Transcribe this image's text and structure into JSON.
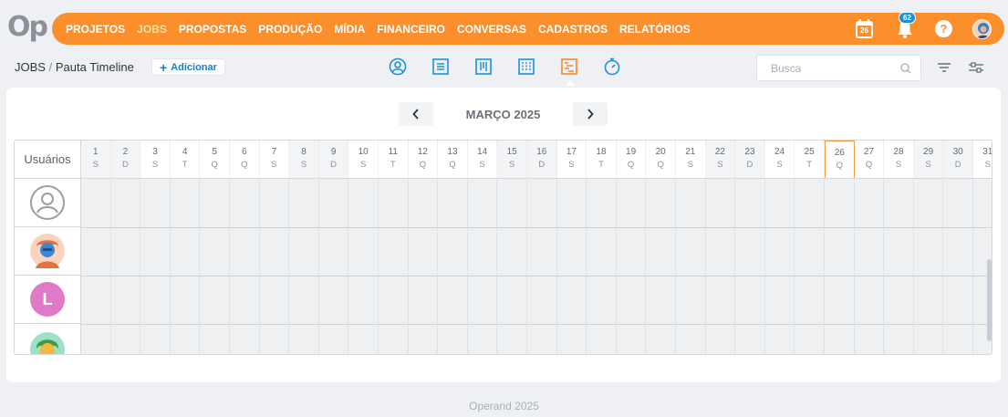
{
  "logo": "Op",
  "nav": {
    "items": [
      "PROJETOS",
      "JOBS",
      "PROPOSTAS",
      "PRODUÇÃO",
      "MÍDIA",
      "FINANCEIRO",
      "CONVERSAS",
      "CADASTROS",
      "RELATÓRIOS"
    ],
    "active": "JOBS",
    "calendar_day": "26",
    "notification_count": "62",
    "help": "?"
  },
  "breadcrumb": {
    "section": "JOBS",
    "separator": "/",
    "page": "Pauta Timeline"
  },
  "add_button": {
    "label": "Adicionar"
  },
  "views": [
    "user-icon",
    "list-icon",
    "kanban-icon",
    "columns-icon",
    "timeline-icon",
    "timer-icon"
  ],
  "active_view": "timeline-icon",
  "search": {
    "placeholder": "Busca"
  },
  "calendar": {
    "month_label": "MARÇO 2025",
    "users_header": "Usuários",
    "today": 26,
    "days": [
      {
        "n": "1",
        "d": "S",
        "we": true
      },
      {
        "n": "2",
        "d": "D",
        "we": true
      },
      {
        "n": "3",
        "d": "S"
      },
      {
        "n": "4",
        "d": "T"
      },
      {
        "n": "5",
        "d": "Q"
      },
      {
        "n": "6",
        "d": "Q"
      },
      {
        "n": "7",
        "d": "S"
      },
      {
        "n": "8",
        "d": "S",
        "we": true
      },
      {
        "n": "9",
        "d": "D",
        "we": true
      },
      {
        "n": "10",
        "d": "S"
      },
      {
        "n": "11",
        "d": "T"
      },
      {
        "n": "12",
        "d": "Q"
      },
      {
        "n": "13",
        "d": "Q"
      },
      {
        "n": "14",
        "d": "S"
      },
      {
        "n": "15",
        "d": "S",
        "we": true
      },
      {
        "n": "16",
        "d": "D",
        "we": true
      },
      {
        "n": "17",
        "d": "S"
      },
      {
        "n": "18",
        "d": "T"
      },
      {
        "n": "19",
        "d": "Q"
      },
      {
        "n": "20",
        "d": "Q"
      },
      {
        "n": "21",
        "d": "S"
      },
      {
        "n": "22",
        "d": "S",
        "we": true
      },
      {
        "n": "23",
        "d": "D",
        "we": true
      },
      {
        "n": "24",
        "d": "S"
      },
      {
        "n": "25",
        "d": "T"
      },
      {
        "n": "26",
        "d": "Q"
      },
      {
        "n": "27",
        "d": "Q"
      },
      {
        "n": "28",
        "d": "S"
      },
      {
        "n": "29",
        "d": "S",
        "we": true
      },
      {
        "n": "30",
        "d": "D",
        "we": true
      },
      {
        "n": "31",
        "d": "S"
      }
    ],
    "users": [
      {
        "type": "placeholder",
        "label": ""
      },
      {
        "type": "avatar-face",
        "label": ""
      },
      {
        "type": "initial",
        "label": "L",
        "color": "#e07ac8"
      },
      {
        "type": "avatar-face-2",
        "label": ""
      }
    ]
  },
  "footer": "Operand 2025",
  "colors": {
    "brand": "#fb8f2c",
    "accent": "#1a93d6",
    "today": "#f29a4a"
  }
}
